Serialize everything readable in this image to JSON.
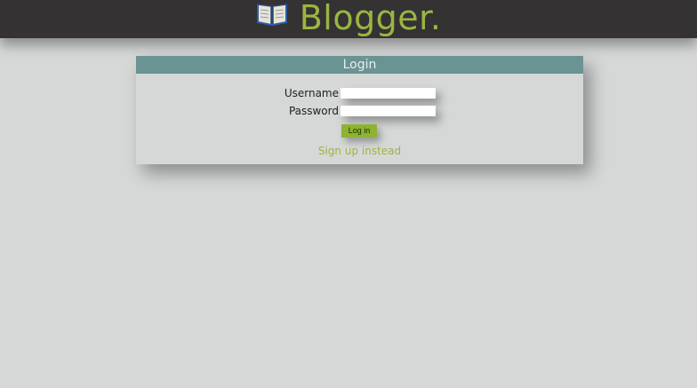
{
  "brand": {
    "icon": "open-book-icon",
    "name": "Blogger.",
    "color": "#9bb542"
  },
  "header": {
    "background": "#343233"
  },
  "login": {
    "title": "Login",
    "username_label": "Username",
    "username_value": "",
    "password_label": "Password",
    "password_value": "",
    "submit_label": "Log in",
    "signup_label": "Sign up instead",
    "title_bar_color": "#6a9393",
    "button_color": "#8db332"
  }
}
